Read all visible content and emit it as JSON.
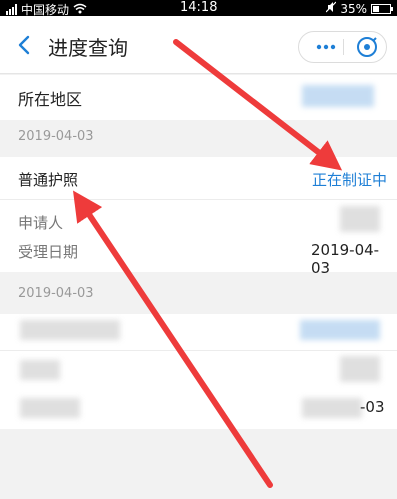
{
  "status_bar": {
    "carrier": "中国移动",
    "time": "14:18",
    "battery": "35%",
    "battery_level": 0.35
  },
  "header": {
    "title": "进度查询"
  },
  "location": {
    "label": "所在地区"
  },
  "records": [
    {
      "date": "2019-04-03",
      "type": "普通护照",
      "status": "正在制证中",
      "applicant_label": "申请人",
      "accept_date_label": "受理日期",
      "accept_date": "2019-04-03"
    },
    {
      "date": "2019-04-03",
      "partial_value": "-03"
    }
  ],
  "colors": {
    "accent": "#1e7fd6",
    "arrow": "#ee3b3b"
  }
}
